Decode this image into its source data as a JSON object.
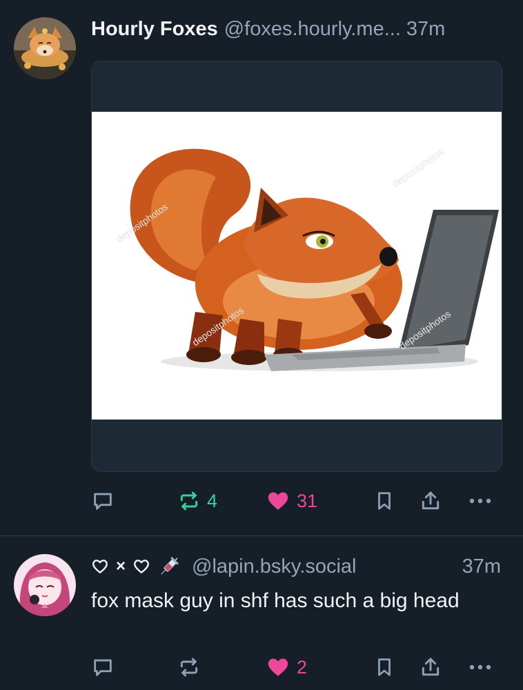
{
  "posts": [
    {
      "display_name": "Hourly Foxes",
      "handle": "@foxes.hourly.me...",
      "time": "37m",
      "embed": {
        "type": "image",
        "watermark": "depositphotos"
      },
      "actions": {
        "reply_count": "",
        "repost_count": "4",
        "like_count": "31",
        "reposted": true,
        "liked": true
      }
    },
    {
      "display_name_emojis": [
        "white-heart",
        "×",
        "white-heart",
        "syringe"
      ],
      "handle": "@lapin.bsky.social",
      "time": "37m",
      "text": "fox mask guy in shf has such a big head",
      "actions": {
        "reply_count": "",
        "repost_count": "",
        "like_count": "2",
        "reposted": false,
        "liked": true
      }
    }
  ],
  "colors": {
    "background": "#161e27",
    "divider": "#2e3a48",
    "handle": "#93a5b7",
    "icon": "#8ea2b6",
    "repost_active": "#34d399",
    "like_active": "#ec4899"
  },
  "icons": [
    "reply-icon",
    "repost-icon",
    "like-icon",
    "bookmark-icon",
    "share-icon",
    "more-icon"
  ]
}
